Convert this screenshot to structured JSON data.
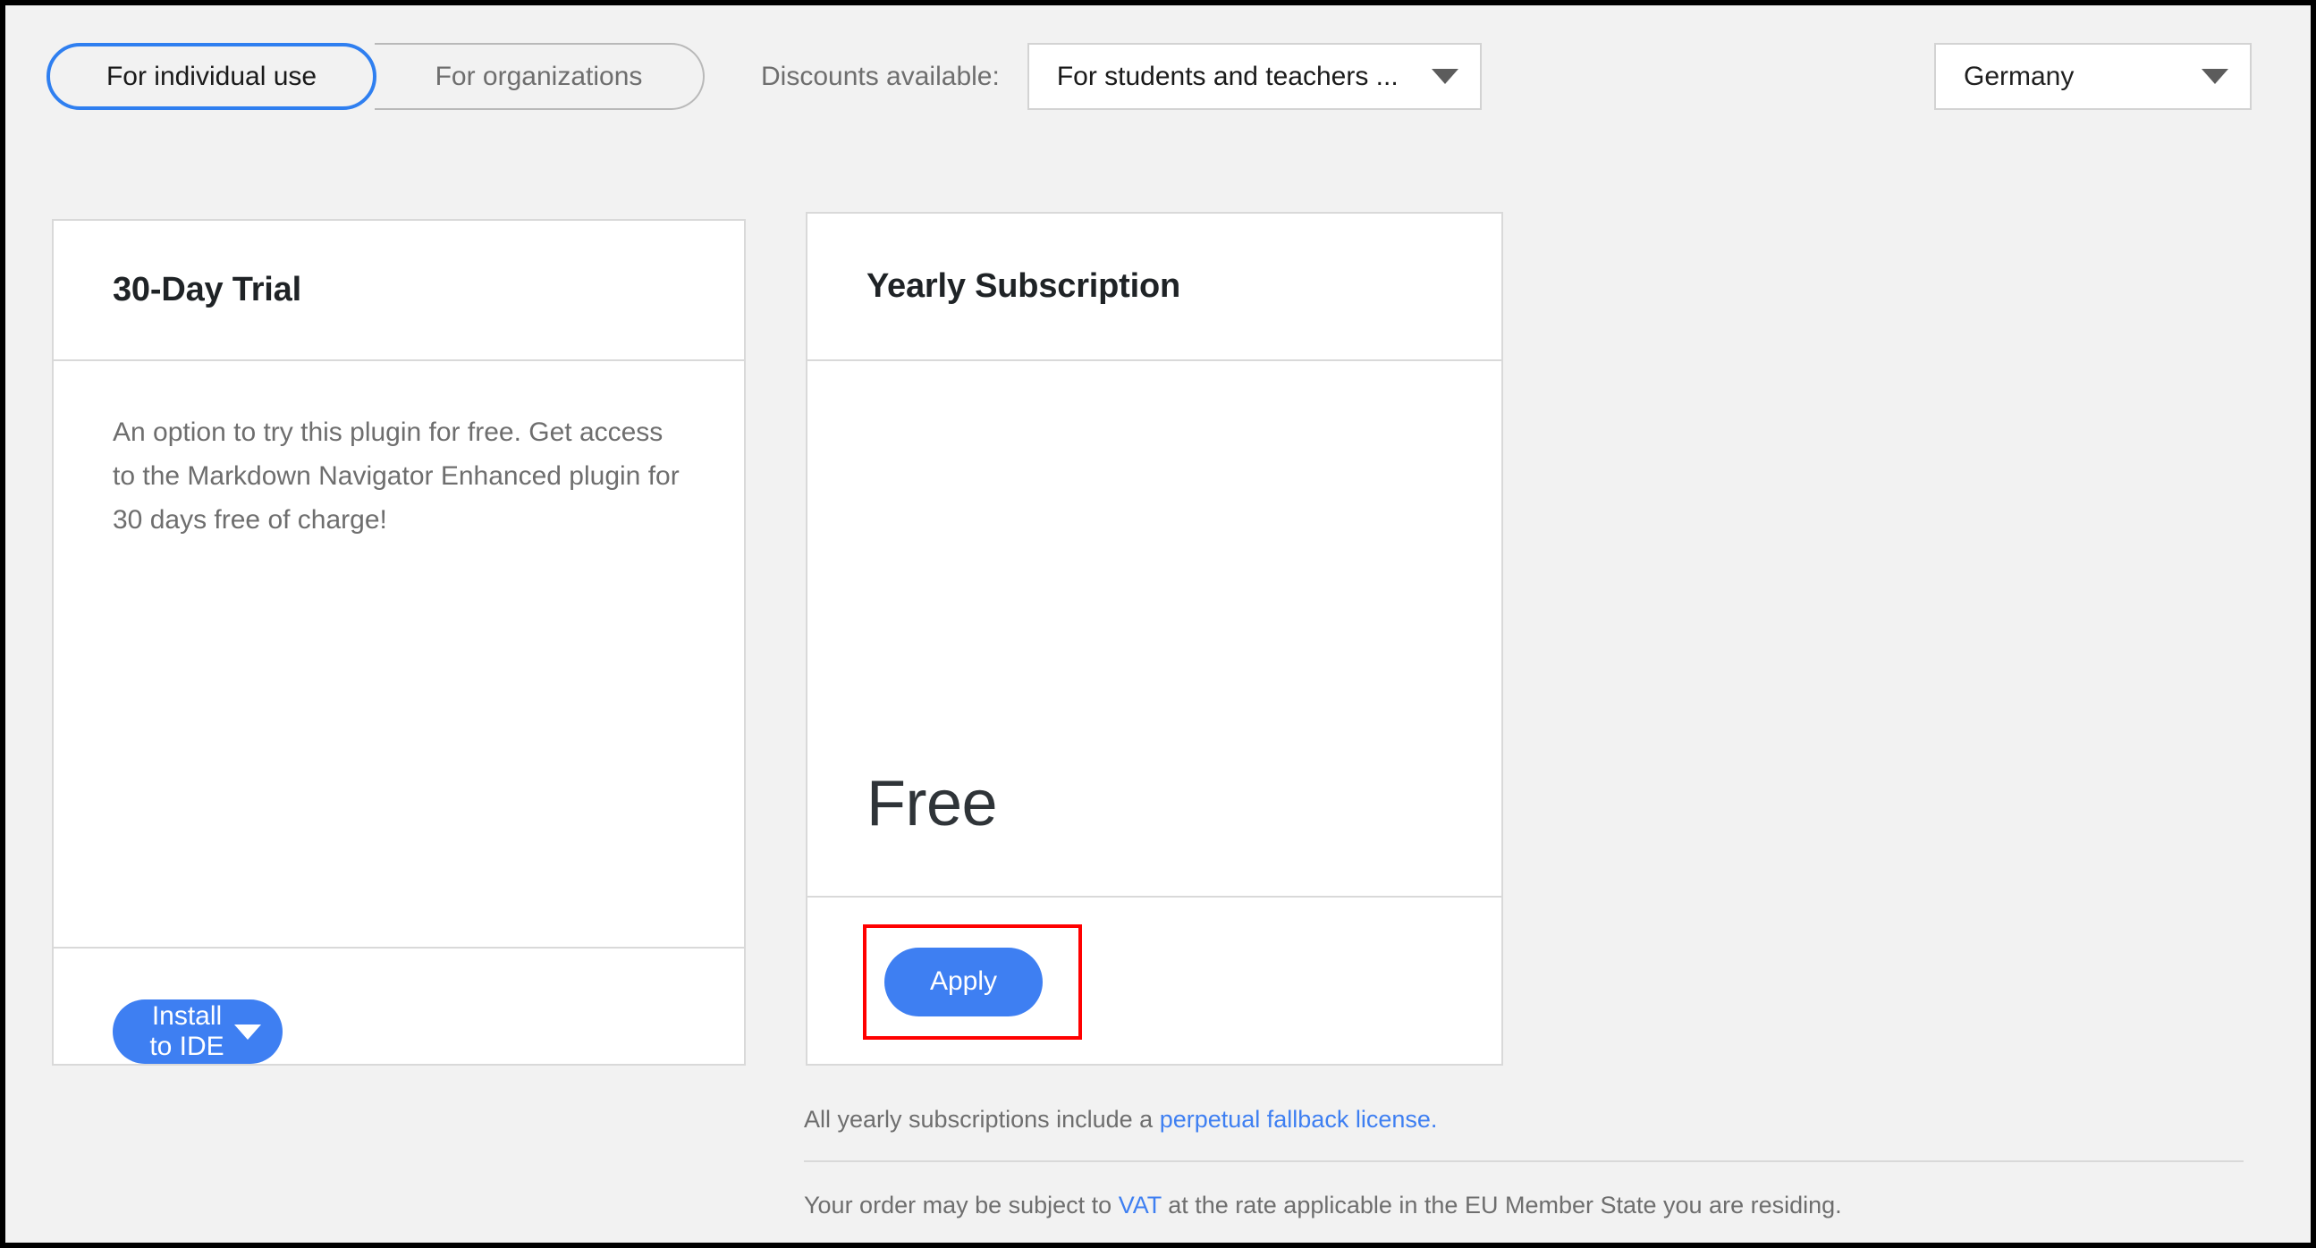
{
  "toolbar": {
    "audience_tabs": [
      {
        "label": "For individual use",
        "active": true
      },
      {
        "label": "For organizations",
        "active": false
      }
    ],
    "discounts_label": "Discounts available:",
    "discount_select_value": "For students and teachers ...",
    "country_select_value": "Germany",
    "caret_icon": "chevron-down-icon"
  },
  "cards": [
    {
      "title": "30-Day Trial",
      "description": "An option to try this plugin for free. Get access to the Markdown Navigator Enhanced plugin for 30 days free of charge!",
      "price": "",
      "action_label": "Install to IDE",
      "action_has_caret": true
    },
    {
      "title": "Yearly Subscription",
      "description": "",
      "price": "Free",
      "action_label": "Apply",
      "action_has_caret": false
    }
  ],
  "footer": {
    "line1_prefix": "All yearly subscriptions include a ",
    "line1_link": "perpetual fallback license.",
    "line2_prefix": "Your order may be subject to ",
    "line2_link": "VAT",
    "line2_suffix": " at the rate applicable in the EU Member State you are residing."
  },
  "colors": {
    "accent_blue": "#3e7ff2",
    "toggle_active_border": "#2f7ff0",
    "highlight_red": "#ff0000",
    "page_background": "#f2f2f2",
    "card_background": "#ffffff",
    "border_gray": "#d9d9d9",
    "text_muted": "#6e6e6e",
    "text_dark": "#1f2326"
  }
}
